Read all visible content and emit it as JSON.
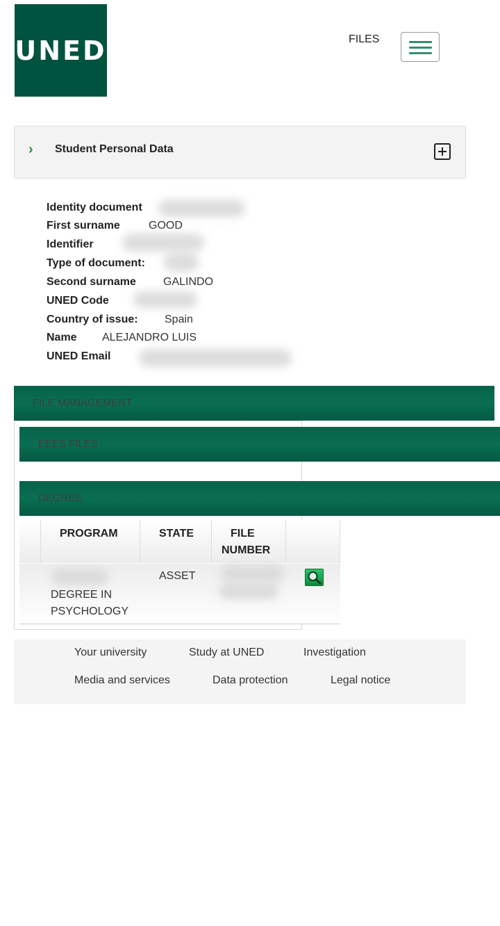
{
  "header": {
    "logo_text": "UNED",
    "files_link": "FILES",
    "menu_icon": "hamburger-menu-icon"
  },
  "personal_data": {
    "title": "Student Personal Data",
    "fields": [
      {
        "label": "Identity document",
        "value": ""
      },
      {
        "label": "First surname",
        "value": "GOOD"
      },
      {
        "label": "Identifier",
        "value": ""
      },
      {
        "label": "Type of document:",
        "value": ""
      },
      {
        "label": "Second surname",
        "value": "GALINDO"
      },
      {
        "label": "UNED Code",
        "value": ""
      },
      {
        "label": "Country of issue:",
        "value": "Spain"
      },
      {
        "label": "Name",
        "value": "ALEJANDRO LUIS"
      },
      {
        "label": "UNED Email",
        "value": ""
      }
    ]
  },
  "file_management": {
    "title": "FILE MANAGEMENT",
    "eees_title": "EEES FILES",
    "degree_title": "DEGREE",
    "table": {
      "headers": [
        "PROGRAM",
        "STATE",
        "FILE",
        "NUMBER"
      ],
      "rows": [
        {
          "program": "DEGREE IN PSYCHOLOGY",
          "state": "ASSET",
          "file_number": ""
        }
      ]
    }
  },
  "footer": {
    "links": [
      "Your university",
      "Study at UNED",
      "Investigation",
      "Media and services",
      "Data protection",
      "Legal notice"
    ]
  },
  "colors": {
    "brand_green": "#00533e",
    "bar_green": "#0a6e52",
    "accent_green": "#2f8f6d"
  }
}
